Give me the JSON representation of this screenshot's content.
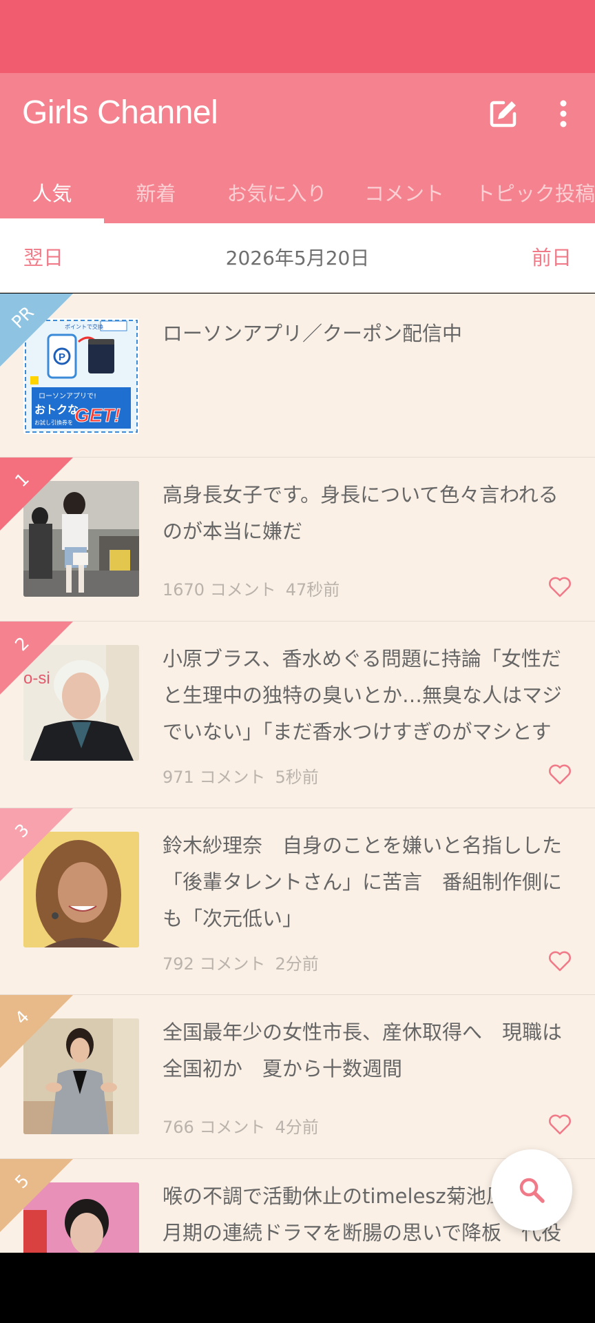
{
  "app": {
    "title": "Girls Channel"
  },
  "colors": {
    "status_bar": "#f15d6f",
    "app_bar": "#f5838f",
    "accent_text": "#f07a88",
    "list_bg": "#faf0e6"
  },
  "toolbar": {
    "edit_icon": "edit-icon",
    "more_icon": "more-vertical-icon"
  },
  "tabs": [
    {
      "label": "人気",
      "active": true
    },
    {
      "label": "新着",
      "active": false
    },
    {
      "label": "お気に入り",
      "active": false
    },
    {
      "label": "コメント",
      "active": false
    },
    {
      "label": "トピック投稿",
      "active": false
    }
  ],
  "date_nav": {
    "next_label": "翌日",
    "current_date": "2026年5月20日",
    "prev_label": "前日"
  },
  "items": [
    {
      "rank": "PR",
      "title": "ローソンアプリ／クーポン配信中",
      "ad_texts": [
        "ポイントで交換",
        "ローソンアプリで!",
        "おトクな",
        "お試し引換券を",
        "GET!"
      ]
    },
    {
      "rank": "1",
      "title": "高身長女子です。身長について色々言われるのが本当に嫌だ",
      "comments": "1670 コメント",
      "time": "47秒前"
    },
    {
      "rank": "2",
      "title": "小原ブラス、香水めぐる問題に持論「女性だと生理中の独特の臭いとか…無臭な人はマジでいない」「まだ香水つけすぎのがマシとす",
      "comments": "971 コメント",
      "time": "5秒前"
    },
    {
      "rank": "3",
      "title": "鈴木紗理奈　自身のことを嫌いと名指しした「後輩タレントさん」に苦言　番組制作側にも「次元低い」",
      "comments": "792 コメント",
      "time": "2分前"
    },
    {
      "rank": "4",
      "title": "全国最年少の女性市長、産休取得へ　現職は全国初か　夏から十数週間",
      "comments": "766 コメント",
      "time": "4分前"
    },
    {
      "rank": "5",
      "title": "喉の不調で活動休止のtimelesz菊池風磨、7月期の連続ドラマを断腸の思いで降板　代役"
    }
  ]
}
